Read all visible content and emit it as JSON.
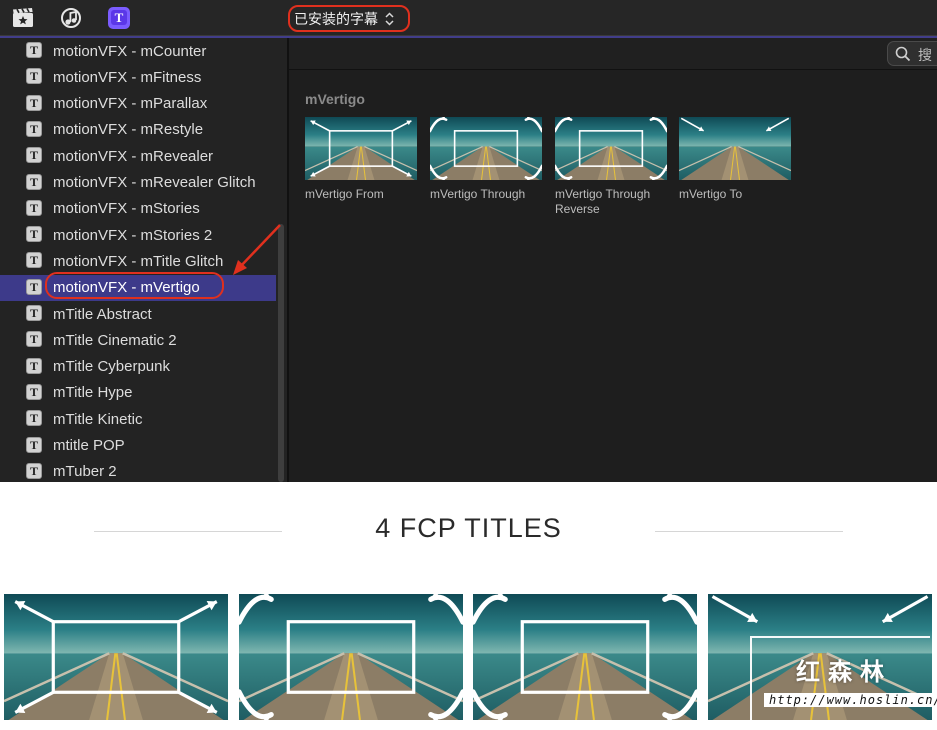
{
  "toolbar": {
    "icons": [
      "media-browser-icon",
      "music-icon",
      "titles-icon"
    ],
    "library_select": "已安装的字幕"
  },
  "sidebar": {
    "items": [
      {
        "label": "motionVFX - mCounter"
      },
      {
        "label": "motionVFX - mFitness"
      },
      {
        "label": "motionVFX - mParallax"
      },
      {
        "label": "motionVFX - mRestyle"
      },
      {
        "label": "motionVFX - mRevealer"
      },
      {
        "label": "motionVFX - mRevealer Glitch"
      },
      {
        "label": "motionVFX - mStories"
      },
      {
        "label": "motionVFX - mStories 2"
      },
      {
        "label": "motionVFX - mTitle Glitch"
      },
      {
        "label": "motionVFX - mVertigo",
        "selected": true
      },
      {
        "label": "mTitle Abstract"
      },
      {
        "label": "mTitle Cinematic 2"
      },
      {
        "label": "mTitle Cyberpunk"
      },
      {
        "label": "mTitle Hype"
      },
      {
        "label": "mTitle Kinetic"
      },
      {
        "label": "mtitle POP"
      },
      {
        "label": "mTuber 2"
      }
    ],
    "item_icon": "T",
    "selection_color": "#3d3a8a"
  },
  "search": {
    "placeholder": "搜"
  },
  "browser": {
    "group": "mVertigo",
    "titles": [
      {
        "label": "mVertigo From",
        "arrows": "from"
      },
      {
        "label": "mVertigo Through",
        "arrows": "through"
      },
      {
        "label": "mVertigo Through Reverse",
        "arrows": "through-reverse"
      },
      {
        "label": "mVertigo To",
        "arrows": "to"
      }
    ]
  },
  "promo": {
    "heading": "4 FCP TITLES",
    "thumbs": [
      "from",
      "through",
      "through-reverse",
      "to"
    ]
  },
  "watermark": {
    "name": "红森林",
    "url": "http://www.hoslin.cn/"
  },
  "colors": {
    "annotation": "#e0301e",
    "accent": "#413d8a"
  }
}
